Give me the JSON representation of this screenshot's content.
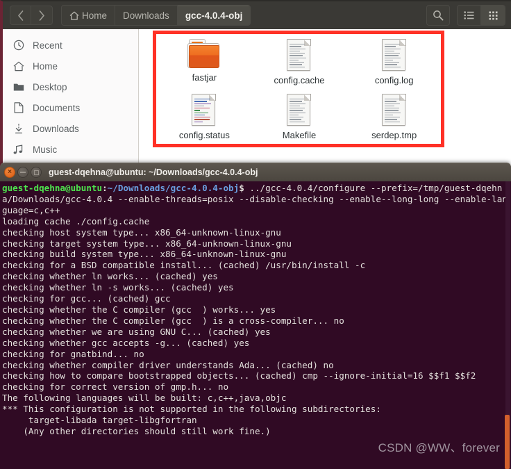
{
  "file_manager": {
    "nav": {
      "back": "‹",
      "forward": "›"
    },
    "breadcrumbs": [
      {
        "label": "Home",
        "icon": "home-icon",
        "active": false
      },
      {
        "label": "Downloads",
        "icon": "",
        "active": false
      },
      {
        "label": "gcc-4.0.4-obj",
        "icon": "",
        "active": true
      }
    ],
    "toolbar": {
      "search_icon": "search-icon",
      "list_view_icon": "list-view-icon",
      "grid_view_icon": "grid-view-icon",
      "active_view": "grid"
    },
    "sidebar": {
      "items": [
        {
          "label": "Recent",
          "icon": "clock-icon"
        },
        {
          "label": "Home",
          "icon": "home-icon"
        },
        {
          "label": "Desktop",
          "icon": "folder-icon"
        },
        {
          "label": "Documents",
          "icon": "document-icon"
        },
        {
          "label": "Downloads",
          "icon": "download-arrow-icon"
        },
        {
          "label": "Music",
          "icon": "music-note-icon"
        }
      ]
    },
    "files": [
      {
        "name": "fastjar",
        "type": "folder"
      },
      {
        "name": "config.cache",
        "type": "document"
      },
      {
        "name": "config.log",
        "type": "document"
      },
      {
        "name": "config.status",
        "type": "document-color"
      },
      {
        "name": "Makefile",
        "type": "document"
      },
      {
        "name": "serdep.tmp",
        "type": "document"
      }
    ],
    "annotation": {
      "color": "#ff3126",
      "shape": "rectangle"
    }
  },
  "terminal": {
    "title": "guest-dqehna@ubuntu: ~/Downloads/gcc-4.0.4-obj",
    "window_buttons": {
      "close": "×",
      "minimize": "minimize-icon",
      "maximize": "maximize-icon"
    },
    "prompt": {
      "user_host": "guest-dqehna@ubuntu",
      "separator": ":",
      "cwd": "~/Downloads/gcc-4.0.4-obj",
      "sigil": "$ "
    },
    "command": "../gcc-4.0.4/configure --prefix=/tmp/guest-dqehna/Downloads/gcc-4.0.4 --enable-threads=posix --disable-checking --enable--long-long --enable-language=c,c++",
    "output": "loading cache ./config.cache\nchecking host system type... x86_64-unknown-linux-gnu\nchecking target system type... x86_64-unknown-linux-gnu\nchecking build system type... x86_64-unknown-linux-gnu\nchecking for a BSD compatible install... (cached) /usr/bin/install -c\nchecking whether ln works... (cached) yes\nchecking whether ln -s works... (cached) yes\nchecking for gcc... (cached) gcc\nchecking whether the C compiler (gcc  ) works... yes\nchecking whether the C compiler (gcc  ) is a cross-compiler... no\nchecking whether we are using GNU C... (cached) yes\nchecking whether gcc accepts -g... (cached) yes\nchecking for gnatbind... no\nchecking whether compiler driver understands Ada... (cached) no\nchecking how to compare bootstrapped objects... (cached) cmp --ignore-initial=16 $$f1 $$f2\nchecking for correct version of gmp.h... no\nThe following languages will be built: c,c++,java,objc\n*** This configuration is not supported in the following subdirectories:\n     target-libada target-libgfortran\n    (Any other directories should still work fine.)",
    "scrollbar": {
      "visible": true,
      "thumb_color": "#d2602c"
    }
  },
  "watermark": {
    "text": "CSDN @WW、forever"
  }
}
